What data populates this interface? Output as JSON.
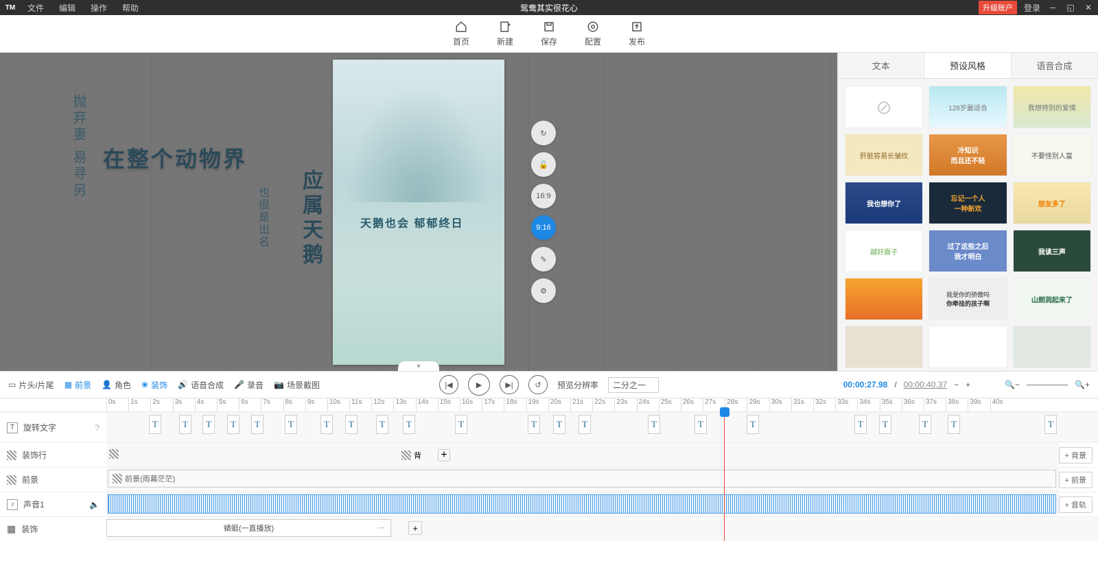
{
  "titlebar": {
    "logo": "TM",
    "menus": [
      "文件",
      "编辑",
      "操作",
      "帮助"
    ],
    "title": "鸳鸯其实很花心",
    "upgrade": "升级账户",
    "login": "登录"
  },
  "toolbar": {
    "home": "首页",
    "new": "新建",
    "save": "保存",
    "config": "配置",
    "publish": "发布"
  },
  "canvas": {
    "extra": "在整个动物界",
    "v1": "抛弃妻\n易寻另",
    "v2": "也很是出名",
    "v3": "应属天鹅",
    "phone_text": "天鹅也会 郁郁终日",
    "ratio_a": "16:9",
    "ratio_b": "9:16"
  },
  "side": {
    "tab_text": "文本",
    "tab_preset": "预设风格",
    "tab_tts": "语音合成",
    "presets": [
      {
        "c": "none",
        "t": "⊘"
      },
      {
        "c": "p-sky",
        "t": "128岁最适合"
      },
      {
        "c": "p-swim",
        "t": "我想特别的爱情"
      },
      {
        "c": "p-liver",
        "t": "肝脏容易长皱纹"
      },
      {
        "c": "p-cold",
        "t": "冷知识",
        "t2": "而且还不轻"
      },
      {
        "c": "p-rich",
        "t": "不要怪别人富"
      },
      {
        "c": "p-blue",
        "t": "我也想你了"
      },
      {
        "c": "p-dark",
        "t": "忘记一个人",
        "t2": "一种新欢"
      },
      {
        "c": "p-friend",
        "t": "朋友多了"
      },
      {
        "c": "p-face",
        "t": "越好面子"
      },
      {
        "c": "p-after",
        "t": "过了这些之后",
        "t2": "我才明白"
      },
      {
        "c": "p-read",
        "t": "我读三声"
      },
      {
        "c": "p-sun",
        "t": ""
      },
      {
        "c": "p-child",
        "t": "我是你的骄傲吗",
        "t2": "你牵挂的孩子啊"
      },
      {
        "c": "p-mount",
        "t": "山朗润起来了"
      },
      {
        "c": "p-grey1",
        "t": ""
      },
      {
        "c": "p-white1",
        "t": ""
      },
      {
        "c": "p-grey2",
        "t": ""
      }
    ]
  },
  "controls": {
    "head_tail": "片头/片尾",
    "fg": "前景",
    "role": "角色",
    "decor": "装饰",
    "tts": "语音合成",
    "record": "录音",
    "screenshot": "场景截图",
    "preview_rate": "预览分辨率",
    "rate_value": "二分之一",
    "time_cur": "00:00:27.98",
    "time_tot": "00:00:40.37"
  },
  "tracks": {
    "rotate": "旋转文字",
    "help": "?",
    "t_letter": "T",
    "rotate_positions": [
      62,
      106,
      140,
      176,
      211,
      260,
      312,
      348,
      393,
      432,
      508,
      614,
      651,
      688,
      789,
      857,
      933,
      1090,
      1126,
      1184,
      1226,
      1367
    ],
    "decor_row": "装饰行",
    "decor_bg": "背",
    "add": "+",
    "fg_row": "前景",
    "fg_clip": "前景(雨幕茫茫)",
    "audio_row": "声音1",
    "decor2_row": "装饰",
    "decor2_clip": "蜻蜓(一直播放)",
    "more": "···",
    "btn_bg": "背景",
    "btn_fg": "前景",
    "btn_audio": "音轨"
  },
  "ruler": [
    "0s",
    "1s",
    "2s",
    "3s",
    "4s",
    "5s",
    "6s",
    "7s",
    "8s",
    "9s",
    "10s",
    "11s",
    "12s",
    "13s",
    "14s",
    "15s",
    "16s",
    "17s",
    "18s",
    "19s",
    "20s",
    "21s",
    "22s",
    "23s",
    "24s",
    "25s",
    "26s",
    "27s",
    "28s",
    "29s",
    "30s",
    "31s",
    "32s",
    "33s",
    "34s",
    "35s",
    "36s",
    "37s",
    "38s",
    "39s",
    "40s"
  ]
}
